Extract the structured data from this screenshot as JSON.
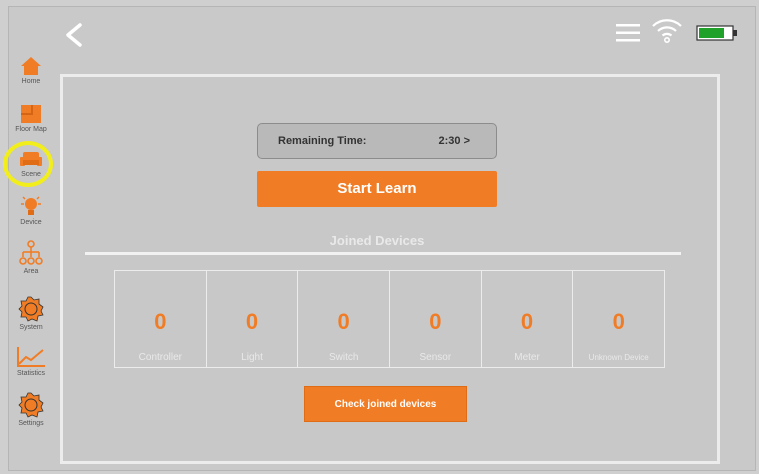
{
  "header": {
    "back_icon": "chevron-left-icon",
    "menu_icon": "hamburger-menu-icon",
    "wifi_icon": "wifi-icon",
    "battery_icon": "battery-icon",
    "battery_color": "#1fa12a"
  },
  "sidebar": {
    "items": [
      {
        "label": "Home",
        "icon": "home-icon"
      },
      {
        "label": "Floor Map",
        "icon": "floor-map-icon"
      },
      {
        "label": "Scene",
        "icon": "sofa-icon"
      },
      {
        "label": "Device",
        "icon": "lightbulb-icon"
      },
      {
        "label": "Area",
        "icon": "area-tree-icon"
      },
      {
        "label": "System",
        "icon": "system-gear-icon"
      },
      {
        "label": "Statistics",
        "icon": "statistics-chart-icon"
      },
      {
        "label": "Settings",
        "icon": "settings-gear-icon"
      }
    ],
    "highlighted": "Scene",
    "highlight_color": "#f2ee1c"
  },
  "main": {
    "remaining_label": "Remaining Time:",
    "remaining_value": "2:30 >",
    "start_button": "Start Learn",
    "joined_title": "Joined Devices",
    "counts": [
      {
        "value": "0",
        "name": "Controller"
      },
      {
        "value": "0",
        "name": "Light"
      },
      {
        "value": "0",
        "name": "Switch"
      },
      {
        "value": "0",
        "name": "Sensor"
      },
      {
        "value": "0",
        "name": "Meter"
      },
      {
        "value": "0",
        "name": "Unknown Device"
      }
    ],
    "check_button": "Check joined devices"
  },
  "colors": {
    "accent": "#f07d25",
    "background": "#c9c9c9",
    "panel_border": "#ececec"
  }
}
